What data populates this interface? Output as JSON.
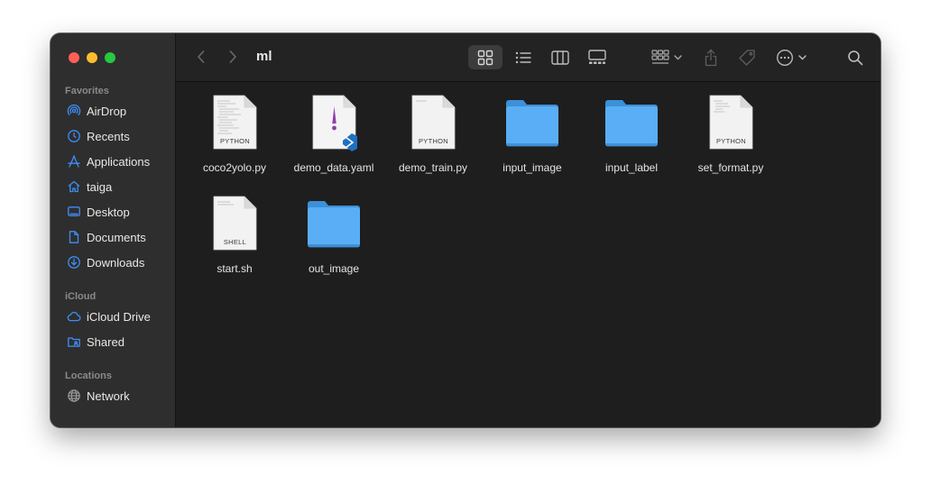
{
  "window": {
    "title": "ml"
  },
  "sidebar": {
    "sections": [
      {
        "title": "Favorites",
        "items": [
          {
            "label": "AirDrop",
            "icon": "airdrop-icon"
          },
          {
            "label": "Recents",
            "icon": "clock-icon"
          },
          {
            "label": "Applications",
            "icon": "applications-icon"
          },
          {
            "label": "taiga",
            "icon": "home-icon"
          },
          {
            "label": "Desktop",
            "icon": "desktop-icon"
          },
          {
            "label": "Documents",
            "icon": "document-icon"
          },
          {
            "label": "Downloads",
            "icon": "download-icon"
          }
        ]
      },
      {
        "title": "iCloud",
        "items": [
          {
            "label": "iCloud Drive",
            "icon": "cloud-icon"
          },
          {
            "label": "Shared",
            "icon": "shared-folder-icon"
          }
        ]
      },
      {
        "title": "Locations",
        "items": [
          {
            "label": "Network",
            "icon": "globe-icon"
          }
        ]
      }
    ]
  },
  "files": [
    {
      "name": "coco2yolo.py",
      "kind": "document",
      "badge": "PYTHON"
    },
    {
      "name": "demo_data.yaml",
      "kind": "yaml"
    },
    {
      "name": "demo_train.py",
      "kind": "document",
      "badge": "PYTHON"
    },
    {
      "name": "input_image",
      "kind": "folder"
    },
    {
      "name": "input_label",
      "kind": "folder"
    },
    {
      "name": "set_format.py",
      "kind": "document",
      "badge": "PYTHON"
    },
    {
      "name": "start.sh",
      "kind": "document",
      "badge": "SHELL"
    },
    {
      "name": "out_image",
      "kind": "folder"
    }
  ],
  "colors": {
    "accent": "#3e8ef7",
    "folder": "#5aaef5",
    "close": "#ff5f57",
    "minimize": "#febc2e",
    "maximize": "#28c840"
  }
}
